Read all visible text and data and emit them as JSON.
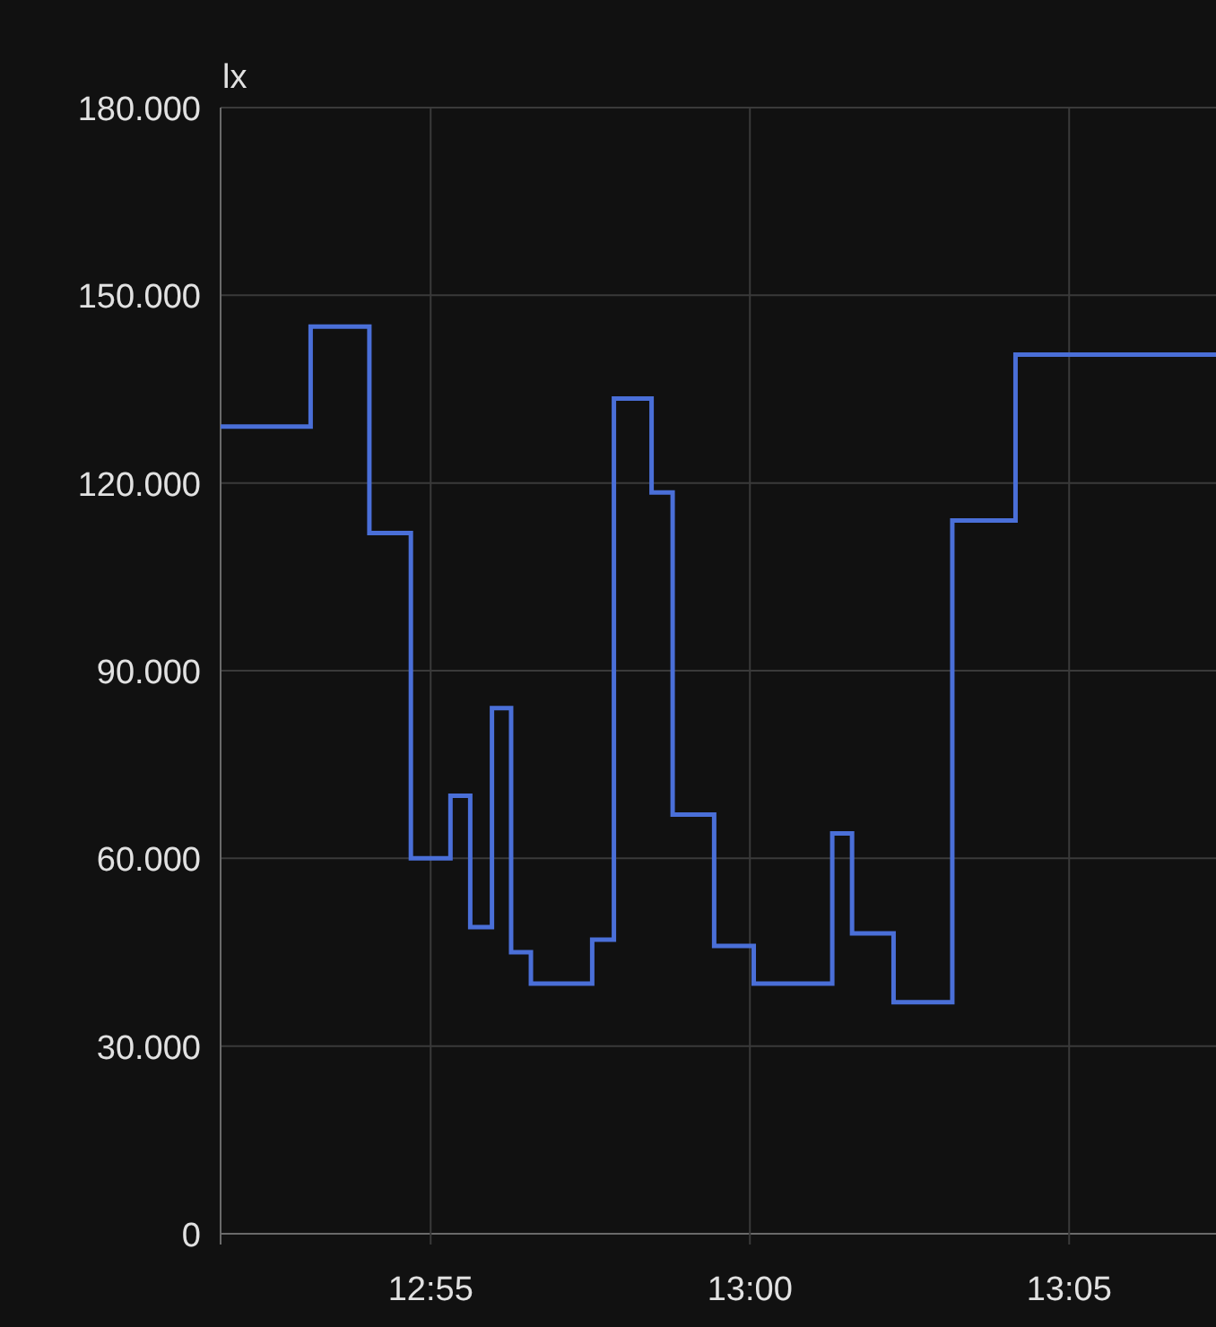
{
  "chart_data": {
    "type": "line",
    "ylabel": "lx",
    "grid": true,
    "x": [
      771.71,
      773.12,
      773.12,
      774.04,
      774.04,
      774.69,
      774.69,
      775.31,
      775.31,
      775.62,
      775.62,
      775.96,
      775.96,
      776.26,
      776.26,
      776.57,
      776.57,
      777.53,
      777.53,
      777.87,
      777.87,
      778.46,
      778.46,
      778.79,
      778.79,
      779.44,
      779.44,
      780.06,
      780.06,
      781.29,
      781.29,
      781.6,
      781.6,
      782.25,
      782.25,
      783.17,
      783.17,
      784.16,
      784.16,
      787.3
    ],
    "series": [
      {
        "color": "#4a6fd8",
        "values": [
          129000,
          129000,
          145000,
          145000,
          112000,
          112000,
          60000,
          60000,
          70000,
          70000,
          49000,
          49000,
          84000,
          84000,
          45000,
          45000,
          40000,
          40000,
          47000,
          47000,
          133500,
          133500,
          118500,
          118500,
          67000,
          67000,
          46000,
          46000,
          40000,
          40000,
          64000,
          64000,
          48000,
          48000,
          37000,
          37000,
          114000,
          114000,
          140500,
          140500
        ]
      }
    ],
    "xlim": [
      771.71,
      787.3
    ],
    "ylim": [
      0,
      180000
    ],
    "xticks": [
      {
        "value": 775,
        "label": "12:55"
      },
      {
        "value": 780,
        "label": "13:00"
      },
      {
        "value": 785,
        "label": "13:05"
      }
    ],
    "yticks": [
      {
        "value": 0,
        "label": "0"
      },
      {
        "value": 30000,
        "label": "30.000"
      },
      {
        "value": 60000,
        "label": "60.000"
      },
      {
        "value": 90000,
        "label": "90.000"
      },
      {
        "value": 120000,
        "label": "120.000"
      },
      {
        "value": 150000,
        "label": "150.000"
      },
      {
        "value": 180000,
        "label": "180.000"
      }
    ]
  }
}
